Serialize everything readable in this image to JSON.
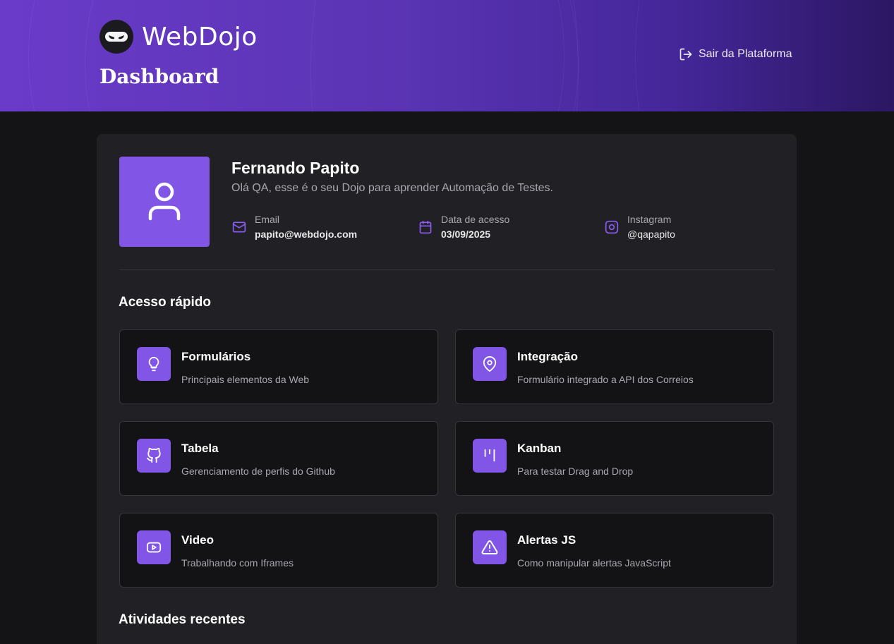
{
  "brand": {
    "name": "WebDojo"
  },
  "header": {
    "title": "Dashboard",
    "logout_label": "Sair da Plataforma"
  },
  "profile": {
    "name": "Fernando Papito",
    "greeting": "Olá QA, esse é o seu Dojo para aprender Automação de Testes.",
    "email": {
      "label": "Email",
      "value": "papito@webdojo.com",
      "icon": "mail-icon"
    },
    "access": {
      "label": "Data de acesso",
      "value": "03/09/2025",
      "icon": "calendar-icon"
    },
    "instagram": {
      "label": "Instagram",
      "value": "@qapapito",
      "icon": "instagram-icon"
    }
  },
  "quick_access": {
    "title": "Acesso rápido",
    "items": [
      {
        "title": "Formulários",
        "desc": "Principais elementos da Web",
        "icon": "lightbulb-icon"
      },
      {
        "title": "Integração",
        "desc": "Formulário integrado a API dos Correios",
        "icon": "map-pin-icon"
      },
      {
        "title": "Tabela",
        "desc": "Gerenciamento de perfis do Github",
        "icon": "github-icon"
      },
      {
        "title": "Kanban",
        "desc": "Para testar Drag and Drop",
        "icon": "kanban-icon"
      },
      {
        "title": "Video",
        "desc": "Trabalhando com Iframes",
        "icon": "youtube-icon"
      },
      {
        "title": "Alertas JS",
        "desc": "Como manipular alertas JavaScript",
        "icon": "alert-triangle-icon"
      }
    ]
  },
  "recent": {
    "title": "Atividades recentes"
  },
  "colors": {
    "accent": "#8155e6",
    "header_start": "#6a3bc9",
    "header_end": "#2b1763",
    "card_bg": "#212125",
    "page_bg": "#141416"
  }
}
